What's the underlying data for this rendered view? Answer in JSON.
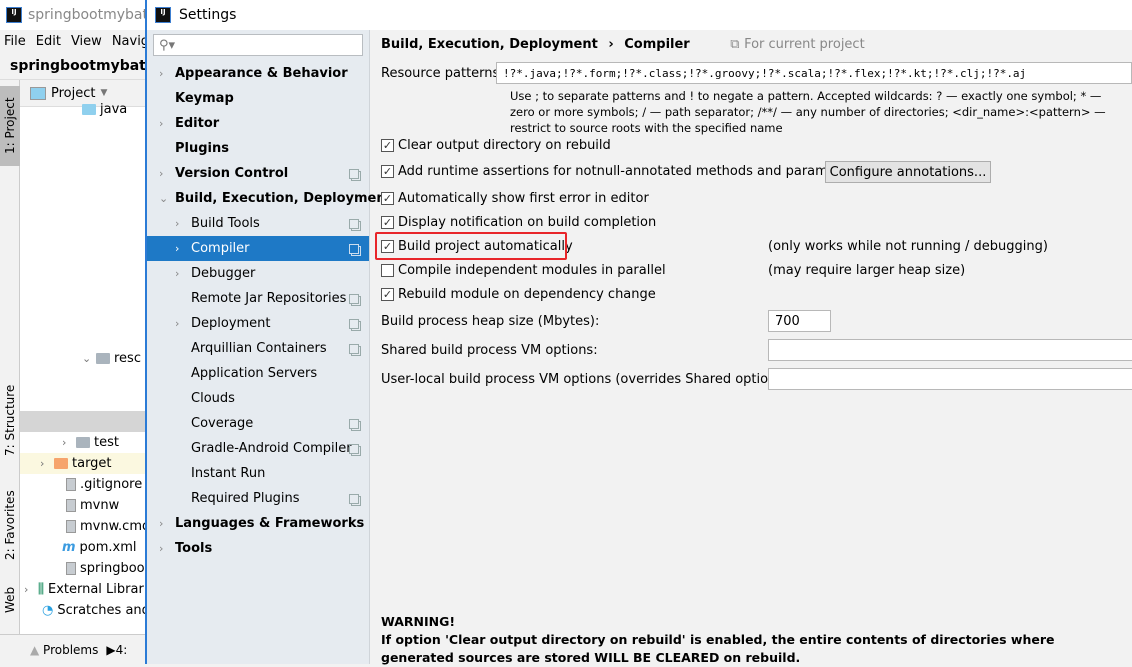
{
  "ide": {
    "title": "springbootmybatis [",
    "menu": [
      "File",
      "Edit",
      "View",
      "Navig"
    ],
    "nav_project": "springbootmybatis",
    "project_view_label": "Project",
    "tool_tabs": [
      "1: Project",
      "7: Structure",
      "2: Favorites",
      "Web"
    ],
    "tree": [
      {
        "label": "java",
        "kind": "folder-src"
      },
      {
        "label": "resc",
        "kind": "folder-res"
      },
      {
        "label": "test",
        "kind": "folder"
      },
      {
        "label": "target",
        "kind": "folder-excluded"
      },
      {
        "label": ".gitignore",
        "kind": "file"
      },
      {
        "label": "mvnw",
        "kind": "file"
      },
      {
        "label": "mvnw.cmd",
        "kind": "file"
      },
      {
        "label": "pom.xml",
        "kind": "maven"
      },
      {
        "label": "springboot",
        "kind": "file"
      },
      {
        "label": "External Librar",
        "kind": "library"
      },
      {
        "label": "Scratches and",
        "kind": "scratches"
      }
    ],
    "status_problems": "Problems",
    "status_run": "4:"
  },
  "dialog": {
    "title": "Settings",
    "search_placeholder": "",
    "nav": [
      {
        "label": "Appearance & Behavior",
        "level": 0,
        "chevron": "right"
      },
      {
        "label": "Keymap",
        "level": 0
      },
      {
        "label": "Editor",
        "level": 0,
        "chevron": "right"
      },
      {
        "label": "Plugins",
        "level": 0
      },
      {
        "label": "Version Control",
        "level": 0,
        "chevron": "right",
        "project": true
      },
      {
        "label": "Build, Execution, Deployment",
        "level": 0,
        "chevron": "down"
      },
      {
        "label": "Build Tools",
        "level": 1,
        "chevron": "right",
        "project": true
      },
      {
        "label": "Compiler",
        "level": 1,
        "chevron": "right",
        "project": true,
        "selected": true
      },
      {
        "label": "Debugger",
        "level": 1,
        "chevron": "right"
      },
      {
        "label": "Remote Jar Repositories",
        "level": 1,
        "project": true
      },
      {
        "label": "Deployment",
        "level": 1,
        "chevron": "right",
        "project": true
      },
      {
        "label": "Arquillian Containers",
        "level": 1,
        "project": true
      },
      {
        "label": "Application Servers",
        "level": 1
      },
      {
        "label": "Clouds",
        "level": 1
      },
      {
        "label": "Coverage",
        "level": 1,
        "project": true
      },
      {
        "label": "Gradle-Android Compiler",
        "level": 1,
        "project": true
      },
      {
        "label": "Instant Run",
        "level": 1
      },
      {
        "label": "Required Plugins",
        "level": 1,
        "project": true
      },
      {
        "label": "Languages & Frameworks",
        "level": 0,
        "chevron": "right"
      },
      {
        "label": "Tools",
        "level": 0,
        "chevron": "right"
      }
    ],
    "breadcrumb": {
      "parent": "Build, Execution, Deployment",
      "sep": "›",
      "current": "Compiler",
      "scope": "For current project"
    },
    "resource_patterns": {
      "label": "Resource patterns:",
      "value": "!?*.java;!?*.form;!?*.class;!?*.groovy;!?*.scala;!?*.flex;!?*.kt;!?*.clj;!?*.aj",
      "help": "Use ; to separate patterns and ! to negate a pattern. Accepted wildcards: ? — exactly one symbol; * — zero or more symbols; / — path separator; /**/ — any number of directories; <dir_name>:<pattern> — restrict to source roots with the specified name"
    },
    "options": [
      {
        "label": "Clear output directory on rebuild",
        "checked": true
      },
      {
        "label": "Add runtime assertions for notnull-annotated methods and parameters",
        "checked": true
      },
      {
        "label": "Automatically show first error in editor",
        "checked": true
      },
      {
        "label": "Display notification on build completion",
        "checked": true
      },
      {
        "label": "Build project automatically",
        "checked": true,
        "highlighted": true,
        "note": "(only works while not running / debugging)"
      },
      {
        "label": "Compile independent modules in parallel",
        "checked": false,
        "note": "(may require larger heap size)"
      },
      {
        "label": "Rebuild module on dependency change",
        "checked": true
      }
    ],
    "configure_annotations": "Configure annotations...",
    "heap_label": "Build process heap size (Mbytes):",
    "heap_value": "700",
    "shared_vm_label": "Shared build process VM options:",
    "shared_vm_value": "",
    "user_vm_label": "User-local build process VM options (overrides Shared options):",
    "user_vm_value": "",
    "warning_title": "WARNING!",
    "warning_text": "If option 'Clear output directory on rebuild' is enabled, the entire contents of directories where generated sources are stored WILL BE CLEARED on rebuild.",
    "highlight_color": "#e8262a",
    "selection_color": "#1e79c6"
  }
}
